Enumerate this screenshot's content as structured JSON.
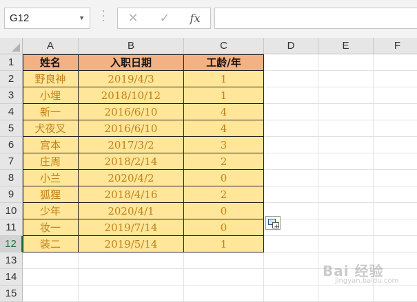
{
  "formula_bar": {
    "name_box": "G12",
    "cancel_glyph": "✕",
    "enter_glyph": "✓",
    "fx_label": "fx",
    "formula_value": ""
  },
  "columns": [
    "A",
    "B",
    "C",
    "D",
    "E",
    "F"
  ],
  "rows": [
    "1",
    "2",
    "3",
    "4",
    "5",
    "6",
    "7",
    "8",
    "9",
    "10",
    "11",
    "12",
    "13",
    "14",
    "15"
  ],
  "table": {
    "headers": [
      "姓名",
      "入职日期",
      "工龄/年"
    ],
    "rows": [
      [
        "野良神",
        "2019/4/3",
        "1"
      ],
      [
        "小埋",
        "2018/10/12",
        "1"
      ],
      [
        "新一",
        "2016/6/10",
        "4"
      ],
      [
        "犬夜叉",
        "2016/6/10",
        "4"
      ],
      [
        "宫本",
        "2017/3/2",
        "3"
      ],
      [
        "庄周",
        "2018/2/14",
        "2"
      ],
      [
        "小兰",
        "2020/4/2",
        "0"
      ],
      [
        "狐狸",
        "2018/4/16",
        "2"
      ],
      [
        "少年",
        "2020/4/1",
        "0"
      ],
      [
        "妆一",
        "2019/7/14",
        "0"
      ],
      [
        "装二",
        "2019/5/14",
        "1"
      ]
    ]
  },
  "active_row": "12",
  "colors": {
    "header_fill": "#f4b183",
    "data_fill": "#ffe699",
    "data_text": "#c0811a",
    "accent": "#217346"
  },
  "watermark": {
    "brand": "Bai 经验",
    "url": "jingyan.baidu.com"
  }
}
